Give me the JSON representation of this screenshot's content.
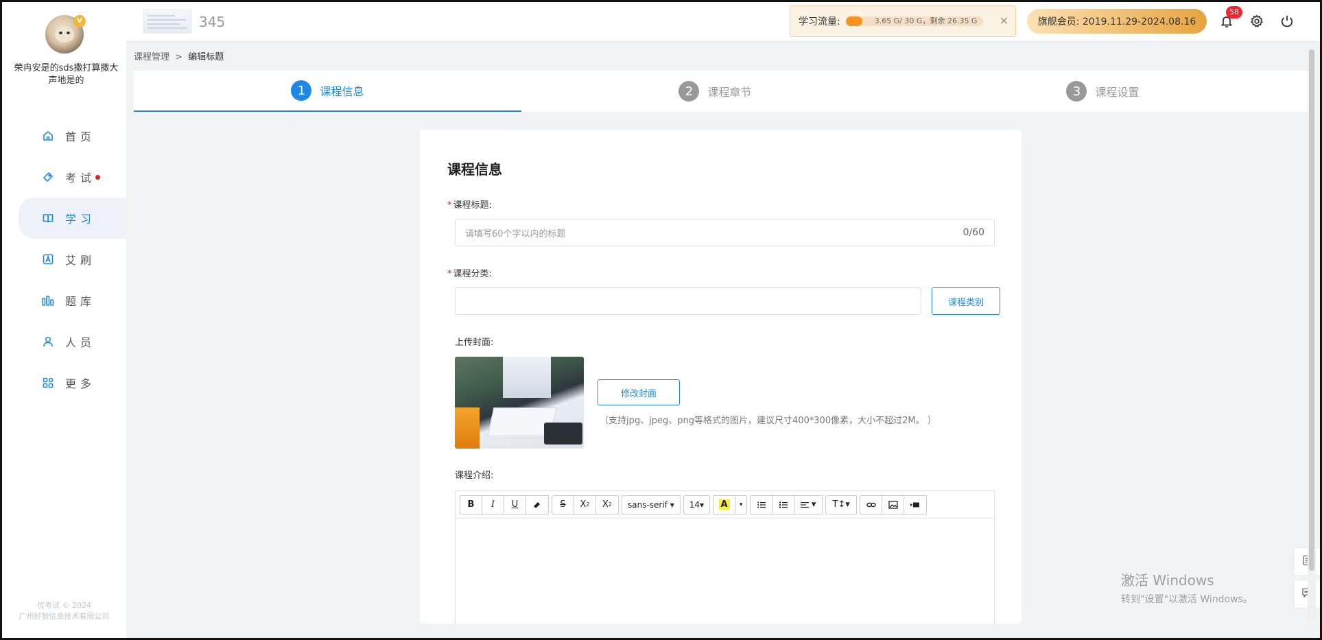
{
  "user": {
    "name": "荣冉安是的sds撒打算撒大声地是的",
    "vip_badge": "V"
  },
  "nav": {
    "items": [
      {
        "label": "首页",
        "icon": "home-icon"
      },
      {
        "label": "考试",
        "icon": "tag-icon",
        "has_dot": true
      },
      {
        "label": "学习",
        "icon": "book-icon",
        "active": true
      },
      {
        "label": "艾刷",
        "icon": "letter-a-icon"
      },
      {
        "label": "题库",
        "icon": "bar-chart-icon"
      },
      {
        "label": "人员",
        "icon": "person-icon"
      },
      {
        "label": "更多",
        "icon": "grid-icon"
      }
    ]
  },
  "footer": {
    "line1": "优考试 © 2024",
    "line2": "广州好智信息技术有限公司"
  },
  "header": {
    "site_title": "345",
    "traffic": {
      "label": "学习流量:",
      "text": "3.65 G/ 30 G，剩余 26.35 G",
      "used_fraction": 0.12
    },
    "member": "旗舰会员: 2019.11.29-2024.08.16",
    "notification_count": "58"
  },
  "breadcrumb": {
    "parent": "课程管理",
    "separator": ">",
    "current": "编辑标题"
  },
  "steps": [
    {
      "num": "1",
      "label": "课程信息",
      "active": true
    },
    {
      "num": "2",
      "label": "课程章节"
    },
    {
      "num": "3",
      "label": "课程设置"
    }
  ],
  "form": {
    "section_title": "课程信息",
    "title_label": "课程标题:",
    "title_placeholder": "请填写60个字以内的标题",
    "title_count": "0/60",
    "category_label": "课程分类:",
    "category_button": "课程类别",
    "cover_label": "上传封面:",
    "cover_button": "修改封面",
    "cover_hint": "（支持jpg、jpeg、png等格式的图片，建议尺寸400*300像素，大小不超过2M。 ）",
    "intro_label": "课程介绍:",
    "required_mark": "*"
  },
  "editor": {
    "font_family": "sans-serif",
    "font_size": "14"
  },
  "watermark": {
    "line1": "激活 Windows",
    "line2": "转到\"设置\"以激活 Windows。"
  },
  "colors": {
    "accent": "#1e88e5",
    "danger": "#f5222d",
    "traffic_fill": "#f7931e"
  }
}
